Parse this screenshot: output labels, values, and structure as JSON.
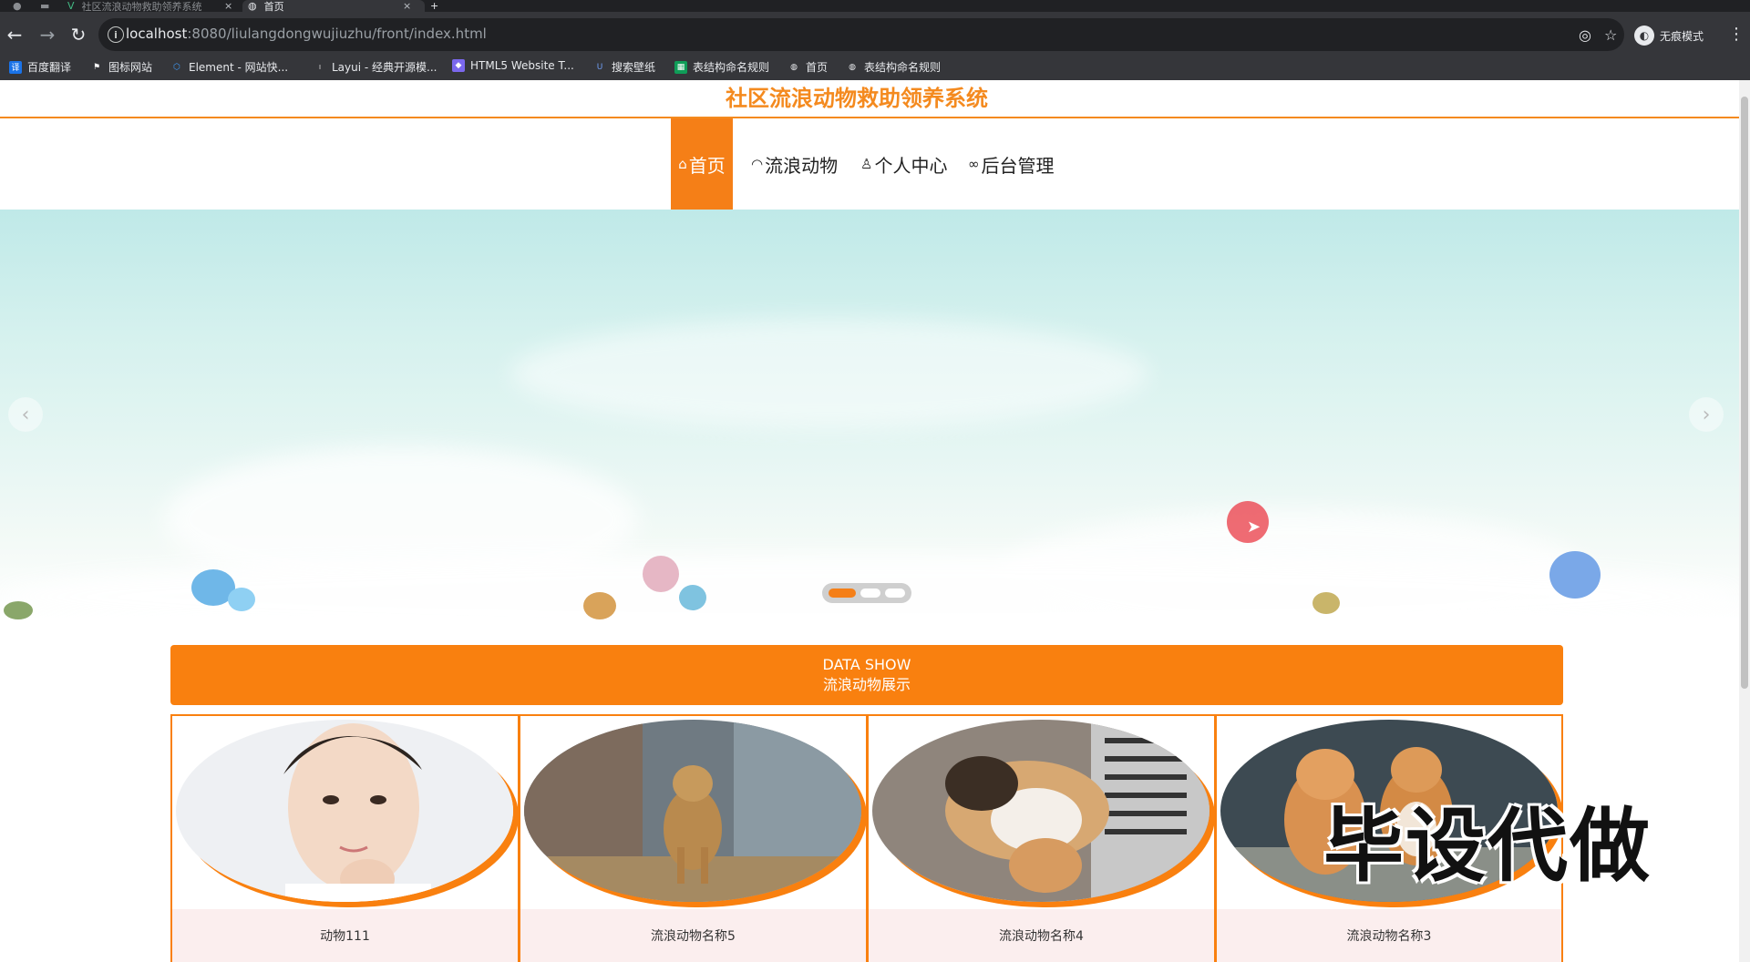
{
  "browser": {
    "tabs": [
      {
        "title": "社区流浪动物救助领养系统",
        "active": false
      },
      {
        "title": "首页",
        "active": true
      }
    ],
    "new_tab": "+",
    "url_host": "localhost",
    "url_rest": ":8080/liulangdongwujiuzhu/front/index.html",
    "profile_label": "无痕模式",
    "bookmarks": [
      {
        "label": "百度翻译",
        "icon": "translate-icon",
        "color": "#1a73e8"
      },
      {
        "label": "图标网站",
        "icon": "flag-icon",
        "color": "#ffffff"
      },
      {
        "label": "Element - 网站快...",
        "icon": "element-icon",
        "color": "#409eff"
      },
      {
        "label": "Layui - 经典开源模...",
        "icon": "layui-icon",
        "color": "#cccccc"
      },
      {
        "label": "HTML5 Website T...",
        "icon": "html5-icon",
        "color": "#7b68ee"
      },
      {
        "label": "搜索壁纸",
        "icon": "wallpaper-icon",
        "color": "#3f6fd8"
      },
      {
        "label": "表结构命名规则",
        "icon": "sheet-icon",
        "color": "#0f9d58"
      },
      {
        "label": "首页",
        "icon": "globe-icon",
        "color": "#e8eaed"
      },
      {
        "label": "表结构命名规则",
        "icon": "globe-icon",
        "color": "#e8eaed"
      }
    ]
  },
  "site": {
    "title": "社区流浪动物救助领养系统",
    "accent": "#f57f17",
    "nav": [
      {
        "label": "首页",
        "icon": "home-icon",
        "active": true
      },
      {
        "label": "流浪动物",
        "icon": "gauge-icon",
        "active": false
      },
      {
        "label": "个人中心",
        "icon": "user-icon",
        "active": false
      },
      {
        "label": "后台管理",
        "icon": "link-icon",
        "active": false
      }
    ],
    "carousel": {
      "slides": 3,
      "active": 0,
      "prev": "‹",
      "next": "›"
    },
    "section": {
      "title_en": "DATA SHOW",
      "title_cn": "流浪动物展示"
    },
    "cards": [
      {
        "name": "动物111",
        "image": "portrait-photo"
      },
      {
        "name": "流浪动物名称5",
        "image": "dog-photo"
      },
      {
        "name": "流浪动物名称4",
        "image": "dog-drain-photo"
      },
      {
        "name": "流浪动物名称3",
        "image": "cats-photo"
      }
    ],
    "watermark": "毕设代做"
  }
}
